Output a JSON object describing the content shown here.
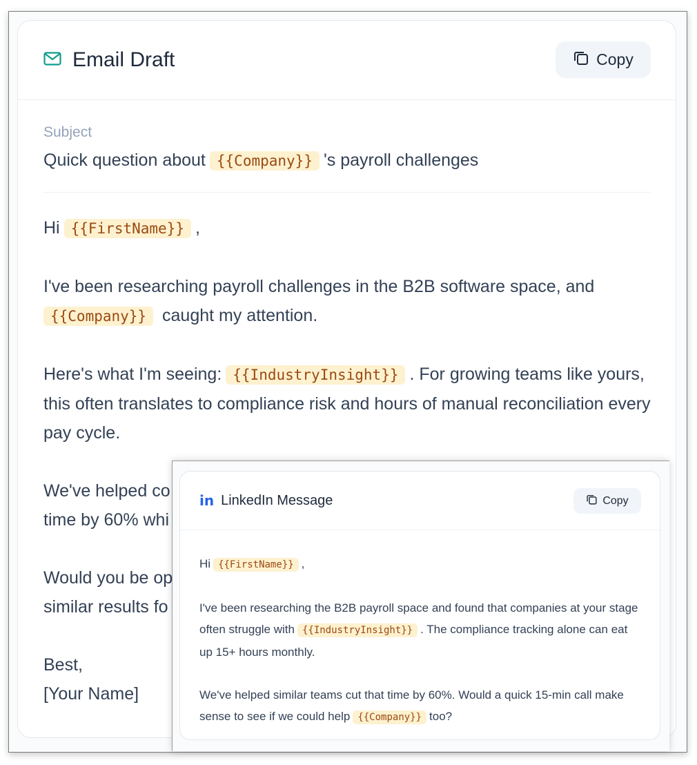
{
  "email": {
    "title": "Email Draft",
    "icon": "mail-icon",
    "copy_label": "Copy",
    "subject_label": "Subject",
    "subject": {
      "before": "Quick question about",
      "tag": "{{Company}}",
      "after": "'s payroll challenges"
    },
    "greeting": {
      "before": "Hi",
      "tag": "{{FirstName}}",
      "after": ","
    },
    "para1": {
      "text": "I've been researching payroll challenges in the B2B software space, and",
      "tag": "{{Company}}",
      "after": "caught my attention."
    },
    "para2": {
      "before": "Here's what I'm seeing:",
      "tag": "{{IndustryInsight}}",
      "after": ". For growing teams like yours, this often translates to compliance risk and hours of manual reconciliation every pay cycle."
    },
    "para3": {
      "line1": "We've helped co",
      "line2": "time by 60% whi"
    },
    "para4": {
      "line1": "Would you be op",
      "line2": "similar results fo"
    },
    "signoff": "Best,",
    "signature": "[Your Name]"
  },
  "linkedin": {
    "title": "LinkedIn Message",
    "icon": "linkedin-icon",
    "icon_glyph": "in",
    "copy_label": "Copy",
    "greeting": {
      "before": "Hi",
      "tag": "{{FirstName}}",
      "after": ","
    },
    "para1": {
      "before": "I've been researching the B2B payroll space and found that companies at your stage often struggle with",
      "tag": "{{IndustryInsight}}",
      "after": ". The compliance tracking alone can eat up 15+ hours monthly."
    },
    "para2": {
      "before": "We've helped similar teams cut that time by 60%. Would a quick 15-min call make sense to see if we could help",
      "tag": "{{Company}}",
      "after": "too?"
    }
  }
}
